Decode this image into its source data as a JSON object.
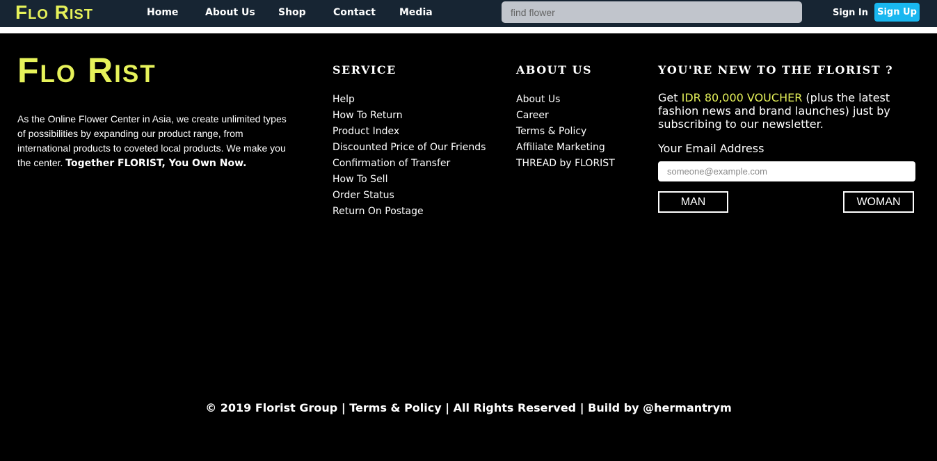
{
  "nav": {
    "brand": "Flo Rist",
    "links": [
      "Home",
      "About Us",
      "Shop",
      "Contact",
      "Media"
    ],
    "search_placeholder": "find flower",
    "signin": "Sign In",
    "signup": "Sign Up"
  },
  "footer": {
    "brand": "Flo Rist",
    "about_text": "As the Online Flower Center in Asia, we create unlimited types of possibilities by expanding our product range, from international products to coveted local products. We make you the center. ",
    "about_tagline": "Together FLORIST, You Own Now.",
    "service": {
      "title": "SERVICE",
      "items": [
        "Help",
        "How To Return",
        "Product Index",
        "Discounted Price of Our Friends",
        "Confirmation of Transfer",
        "How To Sell",
        "Order Status",
        "Return On Postage"
      ]
    },
    "about_us": {
      "title": "ABOUT US",
      "items": [
        "About Us",
        "Career",
        "Terms & Policy",
        "Affiliate Marketing",
        "THREAD by FLORIST"
      ]
    },
    "newsletter": {
      "title": "YOU'RE NEW TO THE FLORIST ?",
      "text_prefix": "Get ",
      "voucher": "IDR 80,000 VOUCHER",
      "text_suffix": " (plus the latest fashion news and brand launches) just by subscribing to our newsletter.",
      "email_label": "Your Email Address",
      "email_placeholder": "someone@example.com",
      "man_label": "MAN",
      "woman_label": "WOMAN"
    },
    "copyright": "© 2019 Florist Group | Terms & Policy | All Rights Reserved | Build by @hermantrym"
  },
  "colors": {
    "navbar_bg": "#172533",
    "brand_yellow": "#e6f25a",
    "signup_blue": "#19b7f0",
    "footer_bg": "#000000"
  }
}
